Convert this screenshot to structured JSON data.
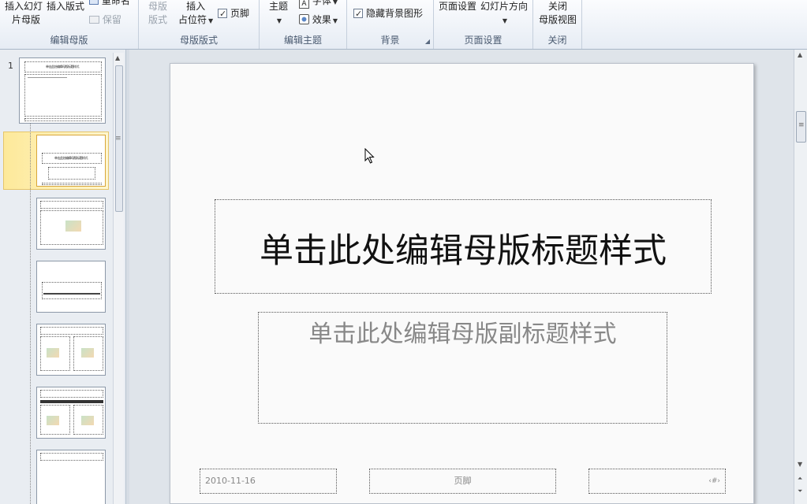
{
  "ribbon": {
    "edit_master": {
      "insert_slide_master_l1": "插入幻灯",
      "insert_slide_master_l2": "片母版",
      "insert_layout": "插入版式",
      "rename": "重命名",
      "preserve": "保留",
      "label": "编辑母版"
    },
    "master_layout": {
      "master_layout_l1": "母版",
      "master_layout_l2": "版式",
      "insert_placeholder_l1": "插入",
      "insert_placeholder_l2": "占位符",
      "footer": "页脚",
      "label": "母版版式"
    },
    "edit_theme": {
      "themes": "主题",
      "fonts": "字体",
      "effects": "效果",
      "label": "编辑主题"
    },
    "background": {
      "hide_bg_graphics": "隐藏背景图形",
      "label": "背景"
    },
    "page_setup": {
      "page_setup": "页面设置",
      "orientation": "幻灯片方向",
      "label": "页面设置"
    },
    "close": {
      "close_l1": "关闭",
      "close_l2": "母版视图",
      "label": "关闭"
    }
  },
  "thumbnails": {
    "slide_number": "1",
    "master_title": "单击此处编辑母版标题样式",
    "layout_title": "单击此处编辑母版标题样式"
  },
  "slide": {
    "title": "单击此处编辑母版标题样式",
    "subtitle": "单击此处编辑母版副标题样式",
    "footer_date": "2010-11-16",
    "footer_text": "页脚",
    "footer_number": "‹#›"
  },
  "icons": {
    "rename": "rename-icon",
    "preserve": "preserve-icon",
    "fonts": "fonts-icon",
    "effects": "effects-icon",
    "dialog_launcher": "dialog-launcher-icon",
    "cursor": "mouse-cursor-icon"
  }
}
